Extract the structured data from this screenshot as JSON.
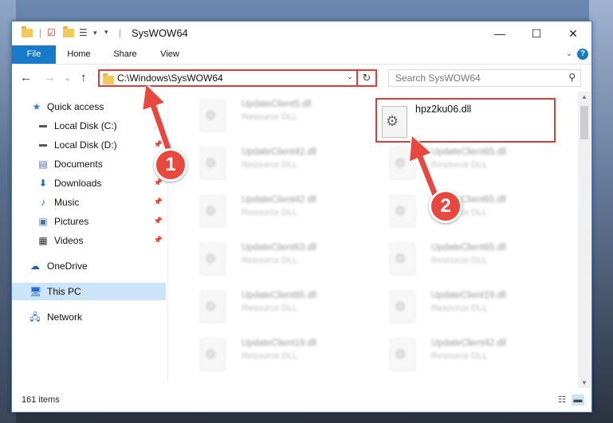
{
  "window": {
    "title": "SysWOW64"
  },
  "ribbon": {
    "tabs": [
      "File",
      "Home",
      "Share",
      "View"
    ]
  },
  "navbar": {
    "address": "C:\\Windows\\SysWOW64",
    "search_placeholder": "Search SysWOW64"
  },
  "sidebar": {
    "items": [
      {
        "label": "Quick access",
        "icon": "star-icon"
      },
      {
        "label": "Local Disk (C:)",
        "icon": "drive-icon"
      },
      {
        "label": "Local Disk (D:)",
        "icon": "drive-icon"
      },
      {
        "label": "Documents",
        "icon": "documents-icon"
      },
      {
        "label": "Downloads",
        "icon": "download-icon"
      },
      {
        "label": "Music",
        "icon": "music-icon"
      },
      {
        "label": "Pictures",
        "icon": "pictures-icon"
      },
      {
        "label": "Videos",
        "icon": "videos-icon"
      },
      {
        "label": "OneDrive",
        "icon": "cloud-icon"
      },
      {
        "label": "This PC",
        "icon": "computer-icon"
      },
      {
        "label": "Network",
        "icon": "network-icon"
      }
    ]
  },
  "files": {
    "left": [
      {
        "name": "UpdateClient5.dll",
        "type": "Resource DLL"
      },
      {
        "name": "UpdateClient42.dll",
        "type": "Resource DLL"
      },
      {
        "name": "UpdateClient42.dll",
        "type": "Resource DLL"
      },
      {
        "name": "UpdateClient63.dll",
        "type": "Resource DLL"
      },
      {
        "name": "UpdateClient65.dll",
        "type": "Resource DLL"
      },
      {
        "name": "UpdateClient19.dll",
        "type": "Resource DLL"
      }
    ],
    "right": [
      {
        "name": "UpdateClient65.dll",
        "type": "Resource DLL"
      },
      {
        "name": "UpdateClient65.dll",
        "type": "Resource DLL"
      },
      {
        "name": "UpdateClient65.dll",
        "type": "Resource DLL"
      },
      {
        "name": "UpdateClient19.dll",
        "type": "Resource DLL"
      },
      {
        "name": "UpdateClient42.dll",
        "type": "Resource DLL"
      }
    ],
    "target": {
      "name": "hpz2ku06.dll"
    }
  },
  "status": {
    "count": "161 items"
  },
  "annotations": {
    "step1": "1",
    "step2": "2",
    "color": "#e8493f"
  }
}
